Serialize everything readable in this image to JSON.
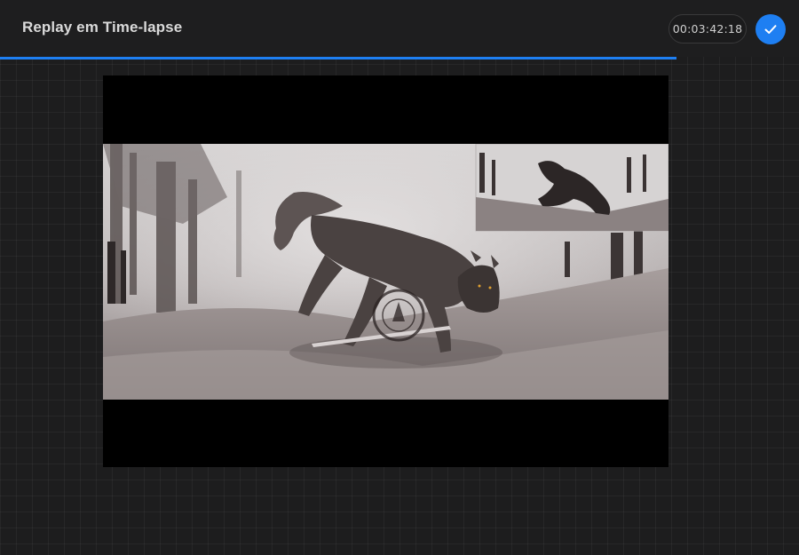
{
  "header": {
    "title": "Replay em Time-lapse",
    "timer": "00:03:42:18",
    "done_icon": "checkmark-icon",
    "accent": "#1e7ff2"
  },
  "playback": {
    "progress_percent": 84.7
  },
  "artwork": {
    "subject": "painting of a snarling wolf in a misty forest with a small inset sketch",
    "watermark_icon": "watermark-seal"
  }
}
